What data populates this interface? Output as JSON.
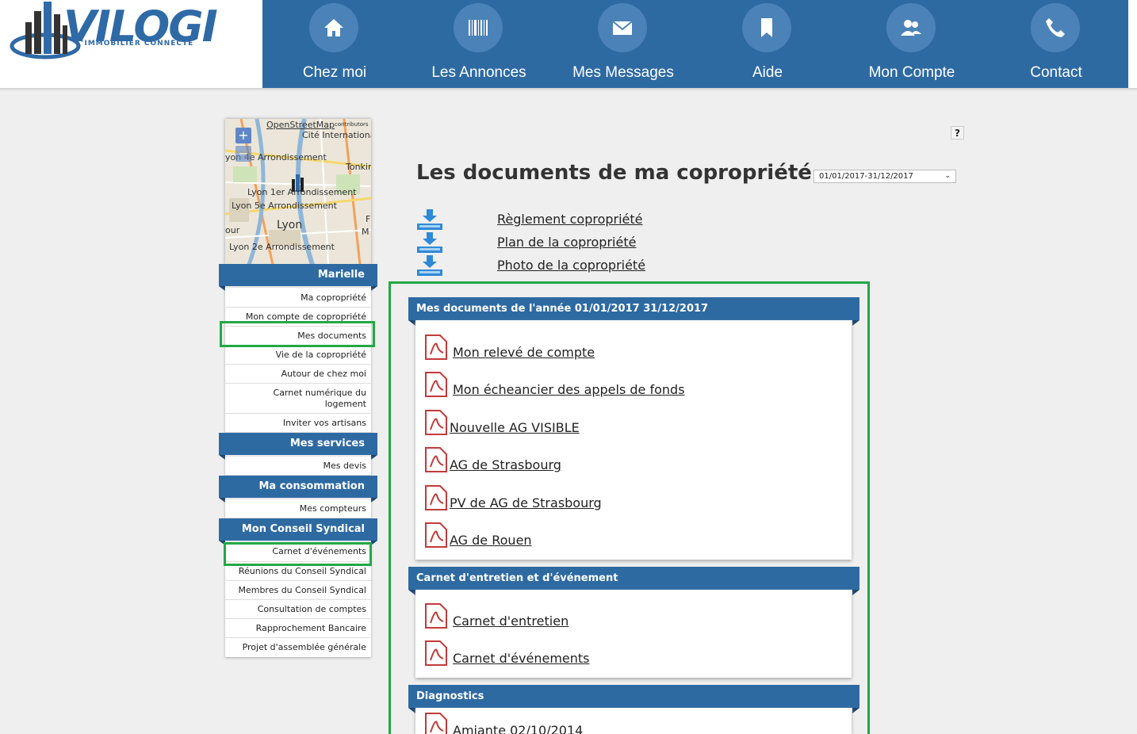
{
  "brand": {
    "name": "VILOGI",
    "tagline": "L'IMMOBILIER CONNECTÉ",
    "accent": "#2e6aa2",
    "highlight": "#22a845"
  },
  "nav": [
    {
      "label": "Chez moi",
      "icon": "home-icon"
    },
    {
      "label": "Les Annonces",
      "icon": "barcode-icon"
    },
    {
      "label": "Mes Messages",
      "icon": "envelope-icon"
    },
    {
      "label": "Aide",
      "icon": "bookmark-icon"
    },
    {
      "label": "Mon Compte",
      "icon": "users-icon"
    },
    {
      "label": "Contact",
      "icon": "phone-icon"
    }
  ],
  "map": {
    "attribution": "OpenStreetMap",
    "attribution_suffix": "contributors",
    "zoom_in": "+",
    "zoom_out": "−",
    "labels": [
      "Cité Internationa",
      "yon 4e Arrondissement",
      "Tonkin",
      "Lyon 1er Arrondissement",
      "Lyon 5e Arrondissement",
      "Lyon",
      "our",
      "M",
      "F",
      "Lyon 2e Arrondissement"
    ]
  },
  "sidebar": {
    "sections": [
      {
        "title": "Marielle",
        "items": [
          "Ma copropriété",
          "Mon compte de copropriété",
          "Mes documents",
          "Vie de la copropriété",
          "Autour de chez moi",
          "Carnet numérique du logement",
          "Inviter vos artisans"
        ]
      },
      {
        "title": "Mes services",
        "items": [
          "Mes devis"
        ]
      },
      {
        "title": "Ma consommation",
        "items": [
          "Mes compteurs"
        ]
      },
      {
        "title": "Mon Conseil Syndical",
        "items": [
          "Carnet d'événements",
          "Réunions du Conseil Syndical",
          "Membres du Conseil Syndical",
          "Consultation de comptes",
          "Rapprochement Bancaire",
          "Projet d'assemblée générale"
        ]
      }
    ]
  },
  "main": {
    "help": "?",
    "title": "Les documents de ma copropriété",
    "period": "01/01/2017-31/12/2017",
    "downloads": [
      "Règlement copropriété",
      "Plan de la copropriété",
      "Photo de la copropriété"
    ],
    "sections": [
      {
        "title": "Mes documents de l'année 01/01/2017 31/12/2017",
        "docs": [
          "Mon relevé de compte",
          "Mon écheancier des appels de fonds ",
          "Nouvelle AG VISIBLE",
          "AG de Strasbourg",
          "PV de AG de Strasbourg",
          "AG de Rouen"
        ]
      },
      {
        "title": "Carnet d'entretien et d'événement",
        "docs": [
          "Carnet d'entretien",
          "Carnet d'événements"
        ]
      },
      {
        "title": "Diagnostics",
        "docs": [
          "Amiante 02/10/2014"
        ]
      }
    ]
  }
}
